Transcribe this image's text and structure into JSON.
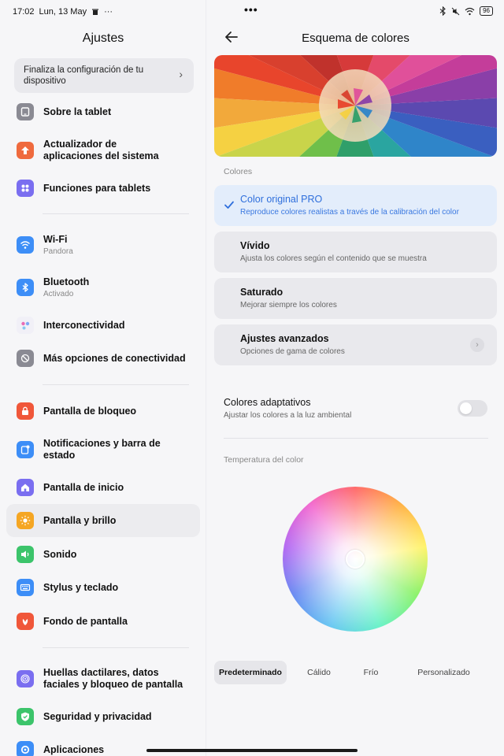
{
  "status_bar": {
    "time": "17:02",
    "date": "Lun, 13 May",
    "more": "···",
    "center_dots": "•••",
    "battery": "96"
  },
  "left": {
    "title": "Ajustes",
    "setup_card": "Finaliza la configuración de tu dispositivo",
    "items": [
      {
        "label": "Sobre la tablet",
        "sub": "",
        "icon": "tablet-icon",
        "color": "#8a8a93"
      },
      {
        "label": "Actualizador de aplicaciones del sistema",
        "sub": "",
        "icon": "upload-arrow-icon",
        "color": "#ef6a3e"
      },
      {
        "label": "Funciones para tablets",
        "sub": "",
        "icon": "grid-icon",
        "color": "#7a6ef0"
      },
      {
        "label": "Wi-Fi",
        "sub": "Pandora",
        "icon": "wifi-icon",
        "color": "#3d8ef7"
      },
      {
        "label": "Bluetooth",
        "sub": "Activado",
        "icon": "bluetooth-icon",
        "color": "#3d8ef7"
      },
      {
        "label": "Interconectividad",
        "sub": "",
        "icon": "interconnect-icon",
        "color": "#eceaf6"
      },
      {
        "label": "Más opciones de conectividad",
        "sub": "",
        "icon": "link-icon",
        "color": "#8a8a93"
      },
      {
        "label": "Pantalla de bloqueo",
        "sub": "",
        "icon": "lock-icon",
        "color": "#f0573a"
      },
      {
        "label": "Notificaciones y barra de estado",
        "sub": "",
        "icon": "notification-icon",
        "color": "#3d8ef7"
      },
      {
        "label": "Pantalla de inicio",
        "sub": "",
        "icon": "home-icon",
        "color": "#7a6ef0"
      },
      {
        "label": "Pantalla y brillo",
        "sub": "",
        "icon": "sun-icon",
        "color": "#f5a623"
      },
      {
        "label": "Sonido",
        "sub": "",
        "icon": "speaker-icon",
        "color": "#3cc46b"
      },
      {
        "label": "Stylus y teclado",
        "sub": "",
        "icon": "keyboard-icon",
        "color": "#3d8ef7"
      },
      {
        "label": "Fondo de pantalla",
        "sub": "",
        "icon": "wallpaper-icon",
        "color": "#f0573a"
      },
      {
        "label": "Huellas dactilares, datos faciales y bloqueo de pantalla",
        "sub": "",
        "icon": "fingerprint-icon",
        "color": "#7a6ef0"
      },
      {
        "label": "Seguridad y privacidad",
        "sub": "",
        "icon": "shield-icon",
        "color": "#3cc46b"
      },
      {
        "label": "Aplicaciones",
        "sub": "",
        "icon": "apps-gear-icon",
        "color": "#3d8ef7"
      }
    ]
  },
  "right": {
    "title": "Esquema de colores",
    "section_colors": "Colores",
    "options": [
      {
        "title": "Color original PRO",
        "sub": "Reproduce colores realistas a través de la calibración del color",
        "selected": true
      },
      {
        "title": "Vívido",
        "sub": "Ajusta los colores según el contenido que se muestra",
        "selected": false
      },
      {
        "title": "Saturado",
        "sub": "Mejorar siempre los colores",
        "selected": false
      },
      {
        "title": "Ajustes avanzados",
        "sub": "Opciones de gama de colores",
        "selected": false
      }
    ],
    "adaptive_title": "Colores adaptativos",
    "adaptive_sub": "Ajustar los colores a la luz ambiental",
    "adaptive_on": false,
    "section_temperature": "Temperatura del color",
    "temp_tabs": [
      "Predeterminado",
      "Cálido",
      "Frío",
      "Personalizado"
    ],
    "temp_selected": "Predeterminado",
    "accent_color": "#2f6fdc"
  }
}
